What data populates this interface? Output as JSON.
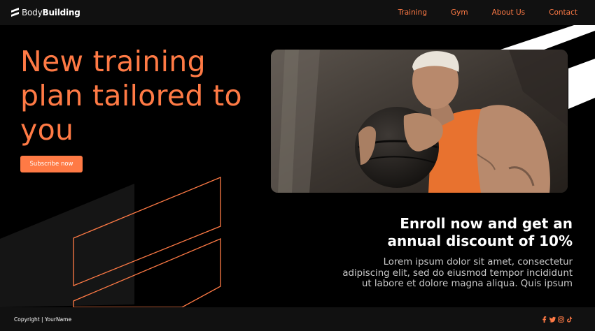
{
  "header": {
    "logo": {
      "part1": "Body",
      "part2": "Building"
    },
    "nav": [
      {
        "label": "Training"
      },
      {
        "label": "Gym"
      },
      {
        "label": "About Us"
      },
      {
        "label": "Contact"
      }
    ]
  },
  "hero": {
    "headline": "New training plan tailored to you",
    "cta_label": "Subscribe now",
    "image": {
      "subject": "man holding medicine ball, orange tank top"
    }
  },
  "promo": {
    "title": "Enroll now and get an annual discount of 10%",
    "body": "Lorem ipsum dolor sit amet, consectetur adipiscing elit, sed do eiusmod tempor incididunt ut labore et dolore magna aliqua. Quis ipsum"
  },
  "footer": {
    "copyright": "Copyright | YourName",
    "socials": [
      "facebook-icon",
      "twitter-icon",
      "instagram-icon",
      "tiktok-icon"
    ]
  },
  "colors": {
    "accent": "#ff7a45",
    "background": "#000000",
    "bar": "#111111"
  }
}
